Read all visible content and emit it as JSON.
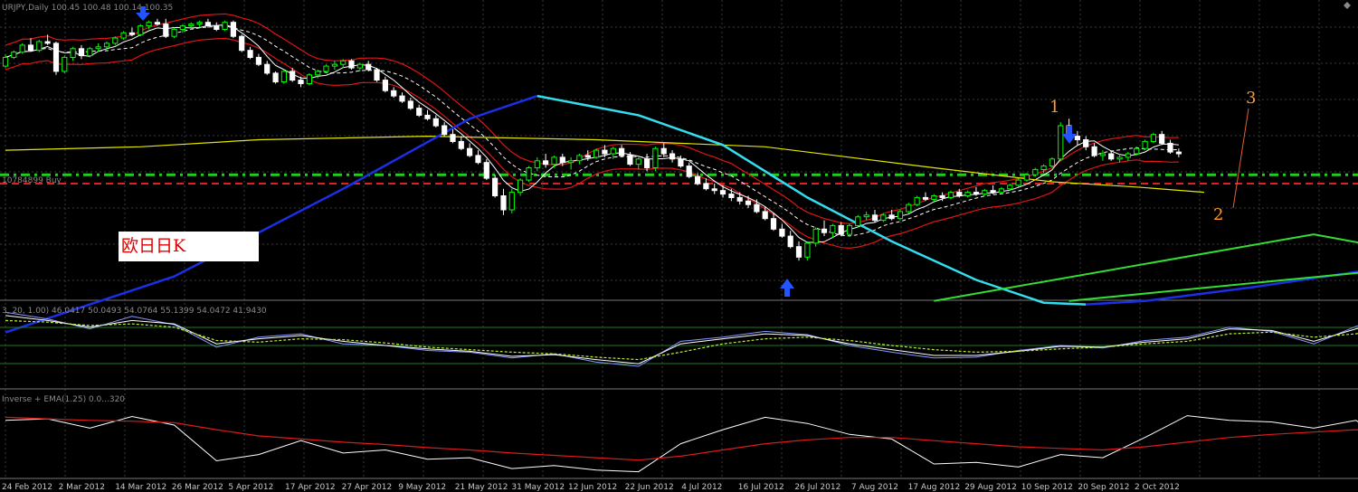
{
  "colors": {
    "background": "#000000",
    "grid": "#3a3a3a",
    "bull": "#00ff00",
    "bear": "#ffffff",
    "bollinger": "#e01515",
    "ma_fast": "#ffffff",
    "ma_slow": "#00cccc",
    "ma_long": "#e6e600",
    "big_cycle_blue": "#1a2fe6",
    "big_cycle_cyan": "#33ddee",
    "trendline": "#33dd33",
    "level_green": "#22cc22",
    "level_red": "#dd2222",
    "annotation": "#ff9933"
  },
  "main_panel": {
    "title": "URJPY,Daily  100.45 100.48 100.14 100.35",
    "level_label": "10784899 Buy",
    "box_text": "欧日日K",
    "annotations": [
      "1",
      "2",
      "3"
    ],
    "arrow_icons": [
      "down-arrow-icon",
      "down-arrow-icon",
      "up-arrow-icon"
    ]
  },
  "osc_panel": {
    "title": "3, 20, 1.00) 46.0417 50.0493 54.0764 55.1399 54.0472 41.9430"
  },
  "bottom_panel": {
    "title": "Inverse + EMA(1.25) 0.0...320"
  },
  "x_axis": {
    "labels": [
      "24 Feb 2012",
      "2 Mar 2012",
      "14 Mar 2012",
      "26 Mar 2012",
      "5 Apr 2012",
      "17 Apr 2012",
      "27 Apr 2012",
      "9 May 2012",
      "21 May 2012",
      "31 May 2012",
      "12 Jun 2012",
      "22 Jun 2012",
      "4 Jul 2012",
      "16 Jul 2012",
      "26 Jul 2012",
      "7 Aug 2012",
      "17 Aug 2012",
      "29 Aug 2012",
      "10 Sep 2012",
      "20 Sep 2012",
      "2 Oct 2012"
    ]
  },
  "chart_data": {
    "type": "candlestick",
    "ohlc": [
      [
        130.0,
        137.0,
        129.0,
        135.0
      ],
      [
        135.0,
        139.0,
        134.0,
        138.0
      ],
      [
        138.0,
        143.0,
        137.0,
        142.0
      ],
      [
        142.0,
        146.0,
        140.0,
        139.0
      ],
      [
        139.0,
        145.0,
        138.0,
        144.0
      ],
      [
        144.0,
        148.0,
        142.0,
        143.0
      ],
      [
        143.0,
        144.0,
        125.0,
        127.0
      ],
      [
        127.0,
        136.0,
        126.0,
        135.0
      ],
      [
        135.0,
        141.0,
        133.0,
        140.0
      ],
      [
        140.0,
        142.0,
        134.0,
        136.0
      ],
      [
        136.0,
        141.0,
        135.0,
        140.0
      ],
      [
        140.0,
        143.0,
        138.0,
        141.0
      ],
      [
        141.0,
        144.0,
        139.0,
        143.0
      ],
      [
        143.0,
        147.0,
        142.0,
        146.0
      ],
      [
        146.0,
        150.0,
        145.0,
        149.0
      ],
      [
        149.0,
        152.0,
        147.0,
        148.0
      ],
      [
        148.0,
        154.0,
        147.0,
        153.0
      ],
      [
        153.0,
        156.0,
        151.0,
        155.0
      ],
      [
        155.0,
        157.0,
        153.0,
        154.0
      ],
      [
        154.0,
        157.0,
        146.0,
        147.0
      ],
      [
        147.0,
        152.0,
        146.0,
        151.0
      ],
      [
        151.0,
        154.0,
        149.0,
        153.0
      ],
      [
        153.0,
        155.0,
        151.0,
        154.0
      ],
      [
        154.0,
        156.0,
        152.0,
        155.0
      ],
      [
        155.0,
        157.0,
        152.0,
        153.0
      ],
      [
        153.0,
        155.0,
        150.0,
        151.0
      ],
      [
        151.0,
        156.0,
        150.0,
        155.0
      ],
      [
        155.0,
        156.0,
        146.0,
        147.0
      ],
      [
        147.0,
        148.0,
        138.0,
        139.0
      ],
      [
        139.0,
        141.0,
        134.0,
        135.0
      ],
      [
        135.0,
        137.0,
        130.0,
        131.0
      ],
      [
        131.0,
        133.0,
        125.0,
        126.0
      ],
      [
        126.0,
        127.0,
        120.0,
        121.0
      ],
      [
        121.0,
        128.0,
        120.0,
        127.0
      ],
      [
        127.0,
        129.0,
        121.0,
        122.0
      ],
      [
        122.0,
        124.0,
        118.0,
        120.0
      ],
      [
        120.0,
        126.0,
        119.0,
        125.0
      ],
      [
        125.0,
        128.0,
        123.0,
        127.0
      ],
      [
        127.0,
        131.0,
        126.0,
        130.0
      ],
      [
        130.0,
        133.0,
        128.0,
        131.0
      ],
      [
        131.0,
        134.0,
        129.0,
        133.0
      ],
      [
        133.0,
        134.0,
        128.0,
        129.0
      ],
      [
        129.0,
        132.0,
        127.0,
        131.0
      ],
      [
        131.0,
        133.0,
        127.0,
        128.0
      ],
      [
        128.0,
        129.0,
        121.0,
        122.0
      ],
      [
        122.0,
        124.0,
        115.0,
        116.0
      ],
      [
        116.0,
        118.0,
        112.0,
        113.0
      ],
      [
        113.0,
        115.0,
        109.0,
        110.0
      ],
      [
        110.0,
        112.0,
        105.0,
        106.0
      ],
      [
        106.0,
        108.0,
        101.0,
        102.0
      ],
      [
        102.0,
        105.0,
        99.0,
        100.0
      ],
      [
        100.0,
        102.0,
        95.0,
        96.0
      ],
      [
        96.0,
        98.0,
        90.0,
        91.0
      ],
      [
        91.0,
        94.0,
        86.0,
        87.0
      ],
      [
        87.0,
        90.0,
        82.0,
        83.0
      ],
      [
        83.0,
        86.0,
        78.0,
        79.0
      ],
      [
        79.0,
        82.0,
        74.0,
        75.0
      ],
      [
        75.0,
        77.0,
        65.0,
        66.0
      ],
      [
        66.0,
        68.0,
        55.0,
        56.0
      ],
      [
        56.0,
        60.0,
        45.0,
        48.0
      ],
      [
        48.0,
        60.0,
        46.0,
        58.0
      ],
      [
        58.0,
        66.0,
        56.0,
        65.0
      ],
      [
        65.0,
        73.0,
        64.0,
        72.0
      ],
      [
        72.0,
        78.0,
        70.0,
        76.0
      ],
      [
        76.0,
        80.0,
        72.0,
        74.0
      ],
      [
        74.0,
        79.0,
        72.0,
        78.0
      ],
      [
        78.0,
        80.0,
        73.0,
        75.0
      ],
      [
        75.0,
        78.0,
        71.0,
        76.0
      ],
      [
        76.0,
        80.0,
        74.0,
        79.0
      ],
      [
        79.0,
        82.0,
        76.0,
        78.0
      ],
      [
        78.0,
        83.0,
        77.0,
        82.0
      ],
      [
        82.0,
        85.0,
        78.0,
        80.0
      ],
      [
        80.0,
        84.0,
        77.0,
        83.0
      ],
      [
        83.0,
        85.0,
        78.0,
        79.0
      ],
      [
        79.0,
        81.0,
        73.0,
        74.0
      ],
      [
        74.0,
        78.0,
        71.0,
        77.0
      ],
      [
        77.0,
        80.0,
        70.0,
        72.0
      ],
      [
        72.0,
        84.0,
        70.0,
        83.0
      ],
      [
        83.0,
        86.0,
        78.0,
        80.0
      ],
      [
        80.0,
        82.0,
        75.0,
        77.0
      ],
      [
        77.0,
        79.0,
        72.0,
        73.0
      ],
      [
        73.0,
        75.0,
        66.0,
        67.0
      ],
      [
        67.0,
        69.0,
        62.0,
        63.0
      ],
      [
        63.0,
        66.0,
        59.0,
        60.0
      ],
      [
        60.0,
        63.0,
        57.0,
        59.0
      ],
      [
        59.0,
        62.0,
        55.0,
        57.0
      ],
      [
        57.0,
        60.0,
        53.0,
        55.0
      ],
      [
        55.0,
        58.0,
        51.0,
        53.0
      ],
      [
        53.0,
        56.0,
        49.0,
        51.0
      ],
      [
        51.0,
        54.0,
        46.0,
        47.0
      ],
      [
        47.0,
        50.0,
        42.0,
        43.0
      ],
      [
        43.0,
        46.0,
        36.0,
        37.0
      ],
      [
        37.0,
        40.0,
        32.0,
        33.0
      ],
      [
        33.0,
        36.0,
        26.0,
        27.0
      ],
      [
        27.0,
        30.0,
        19.0,
        21.0
      ],
      [
        21.0,
        30.0,
        19.0,
        29.0
      ],
      [
        29.0,
        38.0,
        27.0,
        37.0
      ],
      [
        37.0,
        42.0,
        33.0,
        35.0
      ],
      [
        35.0,
        40.0,
        32.0,
        39.0
      ],
      [
        39.0,
        41.0,
        33.0,
        34.0
      ],
      [
        34.0,
        40.0,
        33.0,
        39.0
      ],
      [
        39.0,
        45.0,
        38.0,
        44.0
      ],
      [
        44.0,
        47.0,
        42.0,
        45.0
      ],
      [
        45.0,
        48.0,
        41.0,
        42.0
      ],
      [
        42.0,
        46.0,
        41.0,
        45.0
      ],
      [
        45.0,
        48.0,
        42.0,
        43.0
      ],
      [
        43.0,
        48.0,
        42.0,
        47.0
      ],
      [
        47.0,
        52.0,
        46.0,
        51.0
      ],
      [
        51.0,
        56.0,
        50.0,
        55.0
      ],
      [
        55.0,
        58.0,
        53.0,
        54.0
      ],
      [
        54.0,
        57.0,
        52.0,
        56.0
      ],
      [
        56.0,
        58.0,
        53.0,
        55.0
      ],
      [
        55.0,
        59.0,
        54.0,
        58.0
      ],
      [
        58.0,
        60.0,
        55.0,
        56.0
      ],
      [
        56.0,
        59.0,
        55.0,
        58.0
      ],
      [
        58.0,
        61.0,
        56.0,
        57.0
      ],
      [
        57.0,
        60.0,
        56.0,
        59.0
      ],
      [
        59.0,
        62.0,
        57.0,
        58.0
      ],
      [
        58.0,
        61.0,
        57.0,
        60.0
      ],
      [
        60.0,
        63.0,
        59.0,
        62.0
      ],
      [
        62.0,
        66.0,
        61.0,
        65.0
      ],
      [
        65.0,
        69.0,
        64.0,
        68.0
      ],
      [
        68.0,
        72.0,
        67.0,
        71.0
      ],
      [
        71.0,
        74.0,
        69.0,
        73.0
      ],
      [
        73.0,
        78.0,
        72.0,
        77.0
      ],
      [
        77.0,
        98.0,
        76.0,
        96.0
      ],
      [
        96.0,
        100.0,
        88.0,
        90.0
      ],
      [
        90.0,
        93.0,
        85.0,
        88.0
      ],
      [
        88.0,
        90.0,
        82.0,
        84.0
      ],
      [
        84.0,
        86.0,
        78.0,
        79.0
      ],
      [
        79.0,
        82.0,
        76.0,
        80.0
      ],
      [
        80.0,
        82.0,
        76.0,
        77.0
      ],
      [
        77.0,
        80.0,
        75.0,
        78.0
      ],
      [
        78.0,
        81.0,
        76.0,
        80.0
      ],
      [
        80.0,
        84.0,
        79.0,
        83.0
      ],
      [
        83.0,
        88.0,
        82.0,
        87.0
      ],
      [
        87.0,
        92.0,
        86.0,
        91.0
      ],
      [
        91.0,
        93.0,
        85.0,
        86.0
      ],
      [
        86.0,
        88.0,
        80.0,
        81.0
      ],
      [
        81.0,
        83.0,
        78.0,
        80.0
      ]
    ],
    "ma_slow": [
      [
        0,
        95
      ],
      [
        6,
        125
      ],
      [
        12,
        134
      ],
      [
        20,
        147
      ],
      [
        26,
        150
      ],
      [
        32,
        136
      ],
      [
        40,
        125
      ],
      [
        45,
        127
      ],
      [
        52,
        108
      ],
      [
        60,
        82
      ],
      [
        70,
        73
      ],
      [
        80,
        80
      ],
      [
        90,
        62
      ],
      [
        96,
        42
      ],
      [
        104,
        34
      ],
      [
        112,
        47
      ],
      [
        120,
        58
      ],
      [
        128,
        70
      ],
      [
        134,
        82
      ],
      [
        142,
        80
      ]
    ],
    "ma_long": [
      [
        0,
        82
      ],
      [
        16,
        84
      ],
      [
        30,
        88
      ],
      [
        50,
        90
      ],
      [
        70,
        88
      ],
      [
        90,
        84
      ],
      [
        110,
        72
      ],
      [
        124,
        64
      ],
      [
        134,
        61
      ],
      [
        142,
        58
      ]
    ],
    "big_cycle_blue_left": [
      [
        0,
        -22
      ],
      [
        20,
        10
      ],
      [
        40,
        60
      ],
      [
        55,
        100
      ],
      [
        63,
        113
      ]
    ],
    "big_cycle_cyan": [
      [
        63,
        113
      ],
      [
        75,
        102
      ],
      [
        85,
        85
      ],
      [
        95,
        55
      ],
      [
        105,
        30
      ],
      [
        115,
        8
      ],
      [
        123,
        -5
      ],
      [
        128,
        -6
      ]
    ],
    "big_cycle_blue_right": [
      [
        128,
        -6
      ],
      [
        135,
        -4
      ],
      [
        148,
        4
      ],
      [
        162,
        14
      ],
      [
        173,
        25
      ]
    ],
    "levels": {
      "green": 68,
      "red": 63
    },
    "trendlines": [
      [
        [
          110,
          -4
        ],
        [
          155,
          34
        ]
      ],
      [
        [
          155,
          34
        ],
        [
          173,
          18
        ]
      ],
      [
        [
          173,
          18
        ],
        [
          126,
          -4
        ]
      ]
    ],
    "oscillator": {
      "x": [
        0,
        5,
        10,
        15,
        20,
        25,
        30,
        35,
        40,
        45,
        50,
        55,
        60,
        65,
        70,
        75,
        80,
        85,
        90,
        95,
        100,
        105,
        110,
        115,
        120,
        125,
        130,
        135,
        140,
        145,
        150,
        155,
        160,
        165,
        170,
        173
      ],
      "line1": [
        90,
        82,
        70,
        85,
        75,
        48,
        60,
        64,
        52,
        50,
        44,
        42,
        35,
        40,
        30,
        25,
        55,
        60,
        67,
        63,
        50,
        42,
        35,
        36,
        44,
        50,
        47,
        56,
        60,
        72,
        67,
        52,
        73,
        88,
        70,
        58
      ],
      "line2": [
        86,
        80,
        72,
        80,
        76,
        52,
        58,
        62,
        55,
        50,
        46,
        43,
        37,
        39,
        33,
        28,
        52,
        58,
        64,
        62,
        52,
        45,
        38,
        38,
        43,
        49,
        48,
        54,
        58,
        70,
        68,
        55,
        70,
        85,
        72,
        60
      ],
      "signal": [
        80,
        78,
        74,
        76,
        72,
        56,
        54,
        58,
        57,
        53,
        48,
        45,
        42,
        40,
        36,
        33,
        42,
        52,
        58,
        60,
        56,
        50,
        45,
        42,
        43,
        46,
        48,
        52,
        55,
        64,
        66,
        60,
        64,
        76,
        74,
        66
      ]
    },
    "inverse": {
      "x": [
        0,
        5,
        10,
        15,
        20,
        25,
        30,
        35,
        40,
        45,
        50,
        55,
        60,
        65,
        70,
        75,
        80,
        85,
        90,
        95,
        100,
        105,
        110,
        115,
        120,
        125,
        130,
        135,
        140,
        145,
        150,
        155,
        160,
        165,
        170,
        173
      ],
      "line": [
        70,
        72,
        60,
        75,
        64,
        18,
        26,
        44,
        28,
        32,
        20,
        22,
        8,
        12,
        6,
        4,
        40,
        58,
        74,
        66,
        52,
        46,
        14,
        16,
        10,
        26,
        22,
        48,
        76,
        70,
        68,
        60,
        70,
        34,
        44,
        12
      ],
      "ema": [
        74,
        72,
        70,
        69,
        67,
        58,
        50,
        46,
        42,
        39,
        35,
        32,
        28,
        25,
        22,
        19,
        24,
        32,
        40,
        45,
        48,
        48,
        44,
        40,
        36,
        34,
        32,
        36,
        42,
        48,
        52,
        55,
        58,
        54,
        50,
        44
      ]
    }
  }
}
